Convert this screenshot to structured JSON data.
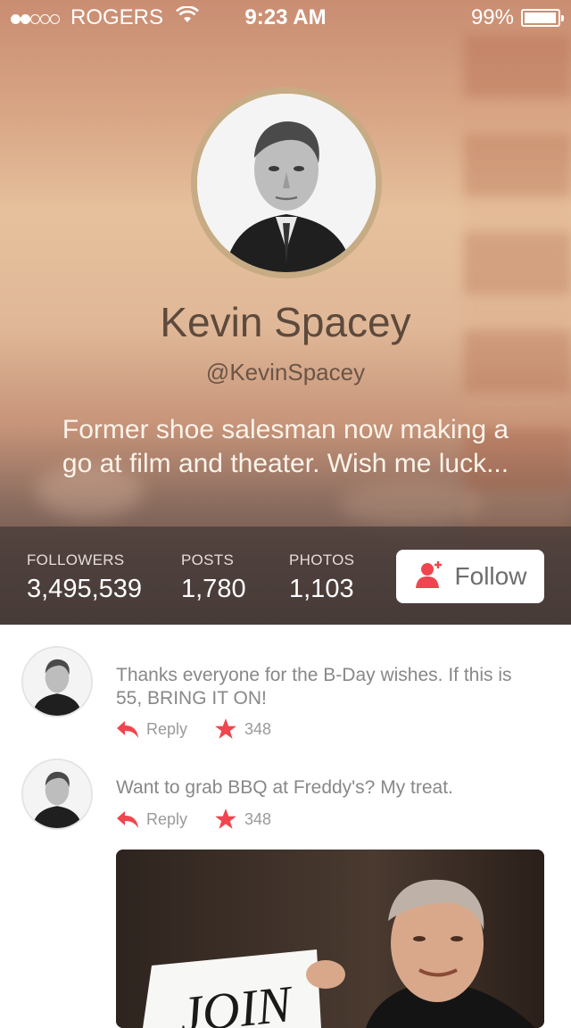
{
  "status_bar": {
    "carrier": "ROGERS",
    "time": "9:23 AM",
    "battery": "99%",
    "signal_icon": "signal-dots-icon",
    "wifi_icon": "wifi-icon",
    "battery_icon": "battery-icon"
  },
  "profile": {
    "name": "Kevin Spacey",
    "handle": "@KevinSpacey",
    "bio": "Former shoe salesman now making a go at film and theater. Wish me luck...",
    "avatar_icon": "avatar-portrait"
  },
  "stats": [
    {
      "label": "FOLLOWERS",
      "value": "3,495,539"
    },
    {
      "label": "POSTS",
      "value": "1,780"
    },
    {
      "label": "PHOTOS",
      "value": "1,103"
    }
  ],
  "follow_button": {
    "label": "Follow",
    "icon": "add-user-icon"
  },
  "posts": [
    {
      "text": "Thanks everyone for the B-Day wishes. If this is 55, BRING IT ON!",
      "reply_label": "Reply",
      "stars": "348"
    },
    {
      "text": "Want to grab BBQ at Freddy's? My treat.",
      "reply_label": "Reply",
      "stars": "348"
    }
  ],
  "photo": {
    "sign_text": "JOIN"
  },
  "colors": {
    "accent": "#f0454f",
    "text_gray": "#888888",
    "name_brown": "#5d4a3c"
  }
}
